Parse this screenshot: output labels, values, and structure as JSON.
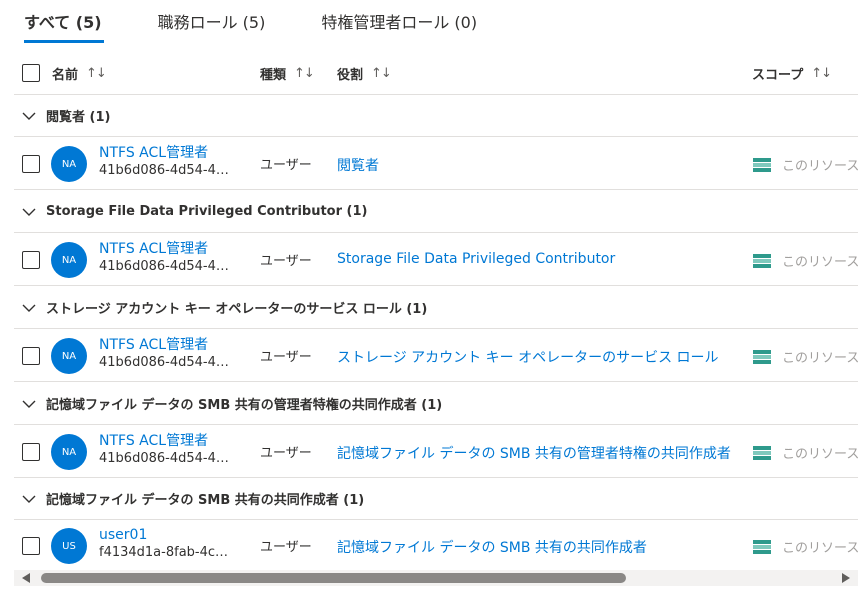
{
  "tabs": [
    {
      "label": "すべて (5)",
      "active": true
    },
    {
      "label": "職務ロール (5)",
      "active": false
    },
    {
      "label": "特権管理者ロール (0)",
      "active": false
    }
  ],
  "columns": {
    "name": "名前",
    "type": "種類",
    "role": "役割",
    "scope": "スコープ",
    "sort_icon": "↑↓"
  },
  "groups": [
    {
      "title": "閲覧者 (1)",
      "row": {
        "avatar": "NA",
        "name": "NTFS ACL管理者",
        "id": "41b6d086-4d54-4…",
        "type": "ユーザー",
        "role": "閲覧者",
        "scope": "このリソース"
      }
    },
    {
      "title": "Storage File Data Privileged Contributor (1)",
      "row": {
        "avatar": "NA",
        "name": "NTFS ACL管理者",
        "id": "41b6d086-4d54-4…",
        "type": "ユーザー",
        "role": "Storage File Data Privileged Contributor",
        "scope": "このリソース"
      }
    },
    {
      "title": "ストレージ アカウント キー オペレーターのサービス ロール (1)",
      "row": {
        "avatar": "NA",
        "name": "NTFS ACL管理者",
        "id": "41b6d086-4d54-4…",
        "type": "ユーザー",
        "role": "ストレージ アカウント キー オペレーターのサービス ロール",
        "scope": "このリソース"
      }
    },
    {
      "title": "記憶域ファイル データの SMB 共有の管理者特権の共同作成者 (1)",
      "row": {
        "avatar": "NA",
        "name": "NTFS ACL管理者",
        "id": "41b6d086-4d54-4…",
        "type": "ユーザー",
        "role": "記憶域ファイル データの SMB 共有の管理者特権の共同作成者",
        "scope": "このリソース"
      }
    },
    {
      "title": "記憶域ファイル データの SMB 共有の共同作成者 (1)",
      "row": {
        "avatar": "US",
        "name": "user01",
        "id": "f4134d1a-8fab-4c…",
        "type": "ユーザー",
        "role": "記憶域ファイル データの SMB 共有の共同作成者",
        "scope": "このリソース"
      }
    }
  ],
  "colors": {
    "accent": "#0078d4",
    "scope_icon": "#2e9a8c"
  },
  "icons": {
    "group_toggle": "chevron-down-icon",
    "scope": "resource-icon",
    "scroll_left": "arrow-left-icon",
    "scroll_right": "arrow-right-icon"
  }
}
